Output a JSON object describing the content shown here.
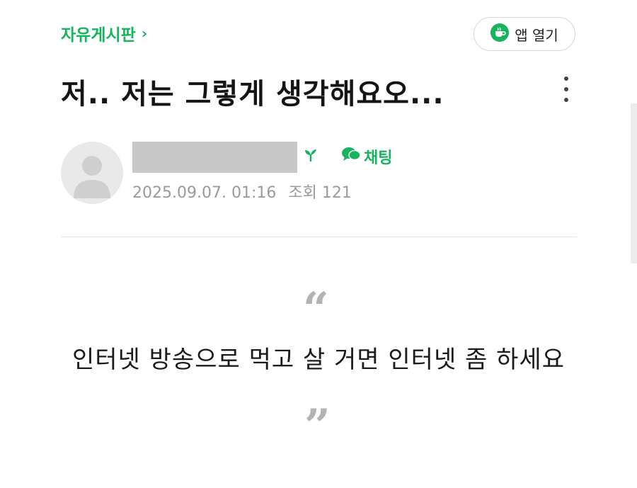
{
  "header": {
    "board_name": "자유게시판",
    "board_chevron": "›",
    "app_button_label": "앱 열기"
  },
  "post": {
    "title": "저.. 저는 그렇게 생각해요오...",
    "author": {
      "chat_label": "채팅"
    },
    "date": "2025.09.07. 01:16",
    "views_label": "조회 121"
  },
  "content": {
    "quote_open": "“",
    "quote_text": "인터넷 방송으로 먹고 살 거면 인터넷 좀 하세요",
    "quote_close": "”"
  },
  "colors": {
    "accent": "#16b45c",
    "meta_text": "#9a9a9a",
    "redaction": "#c8c8c8"
  },
  "icons": {
    "app_button": "cafe-cup-icon",
    "author_level": "sprout-icon",
    "chat": "speech-bubbles-icon",
    "more": "more-vertical-icon"
  }
}
